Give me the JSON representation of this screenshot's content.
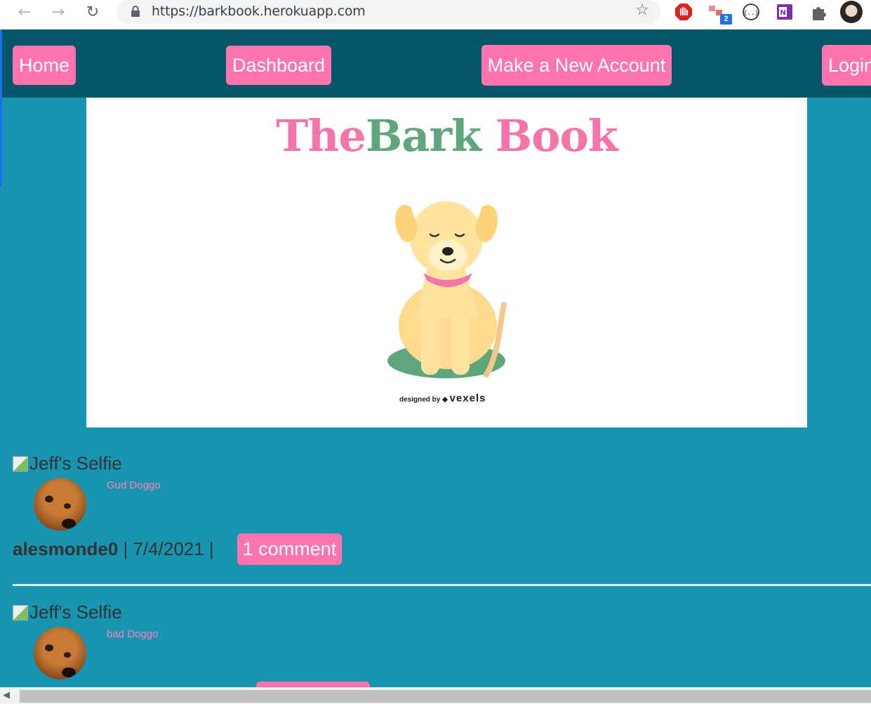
{
  "browser": {
    "url": "https://barkbook.herokuapp.com",
    "extension_badge": "2"
  },
  "navbar": {
    "home": "Home",
    "dashboard": "Dashboard",
    "new_account": "Make a New Account",
    "login": "Login"
  },
  "banner": {
    "title_the": "The",
    "title_bark": "Bark",
    "title_book": "Book",
    "credit_prefix": "designed by",
    "credit_brand": "vexels"
  },
  "posts": [
    {
      "image_alt": "Jeff's Selfie",
      "caption": "Gud Doggo",
      "author": "alesmonde0",
      "date_sep": " | 7/4/2021 | ",
      "comments": "1 comment"
    },
    {
      "image_alt": "Jeff's Selfie",
      "caption": "bad Doggo"
    }
  ],
  "colors": {
    "page_bg": "#1794b0",
    "navbar_bg": "#045769",
    "button_pink": "#ff74ae",
    "logo_pink": "#f774aa",
    "logo_green": "#5ea67c"
  }
}
